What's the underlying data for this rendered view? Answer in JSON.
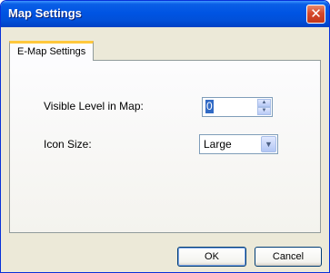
{
  "window": {
    "title": "Map Settings",
    "close_symbol": "✕"
  },
  "tabs": [
    {
      "label": "E-Map Settings",
      "selected": true
    }
  ],
  "settings": {
    "visible_level": {
      "label": "Visible Level in Map:",
      "value": "0"
    },
    "icon_size": {
      "label": "Icon Size:",
      "value": "Large"
    }
  },
  "buttons": {
    "ok_label": "OK",
    "cancel_label": "Cancel"
  },
  "icons": {
    "close": "close-icon",
    "spin_up": "chevron-up-icon",
    "spin_down": "chevron-down-icon",
    "dropdown": "chevron-down-icon"
  },
  "colors": {
    "titlebar": "#0054e3",
    "dialog_background": "#ece9d8",
    "close_button": "#d6492c",
    "tab_highlight": "#ffc83c",
    "selection": "#316ac5"
  }
}
